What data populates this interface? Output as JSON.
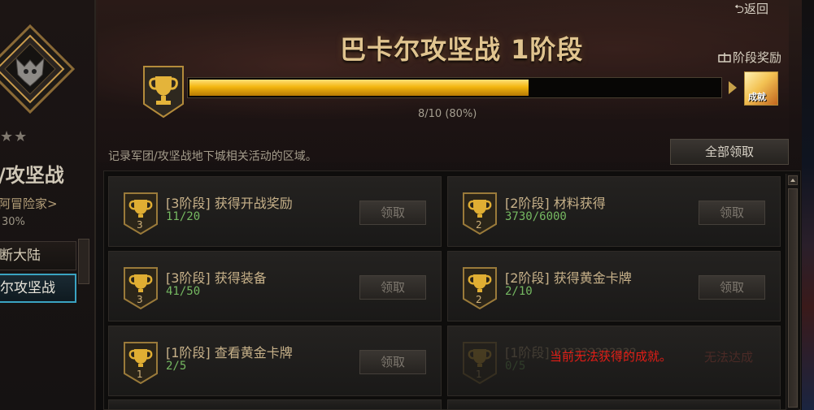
{
  "colors": {
    "accent_gold": "#f3b610",
    "count_green": "#75b861",
    "warning_red": "#e21d16",
    "active_tab_border": "#3aa3c2"
  },
  "left": {
    "rating": "★★",
    "title": "/攻坚战",
    "subtitle": "阿冒险家>",
    "percent": "30%",
    "nav": [
      {
        "label": "断大陆",
        "active": false
      },
      {
        "label": "尔攻坚战",
        "active": true
      }
    ]
  },
  "header": {
    "return_label": "返回",
    "title": "巴卡尔攻坚战 1阶段",
    "stage_reward_label": "阶段奖励",
    "reward_badge": "成就",
    "progress": {
      "current": 8,
      "total": 10,
      "fraction": 0.8,
      "text": "8/10 (80%)"
    },
    "description": "记录军团/攻坚战地下城相关活动的区域。",
    "claim_all_label": "全部领取"
  },
  "achievements": [
    {
      "stage": "3",
      "title": "[3阶段] 获得开战奖励",
      "count": "11/20",
      "button": "领取",
      "locked": false
    },
    {
      "stage": "2",
      "title": "[2阶段] 材料获得",
      "count": "3730/6000",
      "button": "领取",
      "locked": false
    },
    {
      "stage": "3",
      "title": "[3阶段] 获得装备",
      "count": "41/50",
      "button": "领取",
      "locked": false
    },
    {
      "stage": "2",
      "title": "[2阶段] 获得黄金卡牌",
      "count": "2/10",
      "button": "领取",
      "locked": false
    },
    {
      "stage": "1",
      "title": "[1阶段] 查看黄金卡牌",
      "count": "2/5",
      "button": "领取",
      "locked": false
    },
    {
      "stage": "1",
      "title": "[1阶段] ????????????",
      "count": "0/5",
      "locked": true,
      "lock_message": "当前无法获得的成就。",
      "lock_tag": "无法达成"
    }
  ]
}
